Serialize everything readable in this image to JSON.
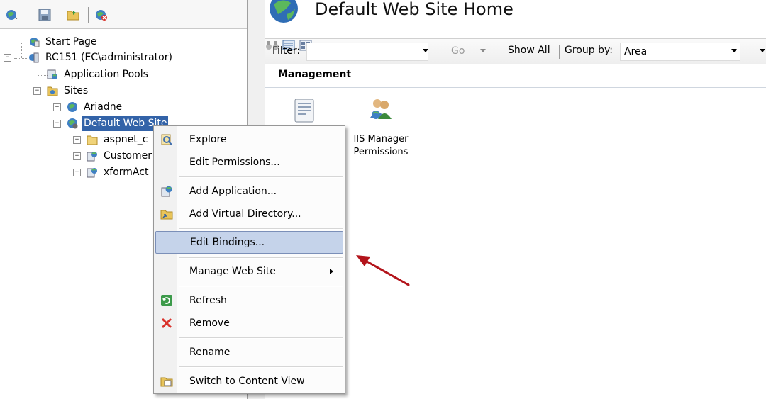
{
  "toolbar": {
    "icons": [
      "connect-globe-icon",
      "save-icon",
      "folder-icon",
      "disconnect-icon"
    ]
  },
  "tree": {
    "start_page": "Start Page",
    "server": "RC151 (EC\\administrator)",
    "app_pools": "Application Pools",
    "sites": "Sites",
    "ariadne": "Ariadne",
    "default_site": "Default Web Site",
    "aspnet": "aspnet_c",
    "customer": "Customer",
    "xform": "xformAct"
  },
  "main": {
    "title": "Default Web Site Home",
    "filter_label": "Filter:",
    "go_label": "Go",
    "show_all_label": "Show All",
    "group_by_label": "Group by:",
    "group_by_value": "Area",
    "section_label": "Management",
    "features": [
      {
        "label_line1": "",
        "label_line2": "",
        "icon": "configuration-editor-icon"
      },
      {
        "label_line1": "IIS Manager",
        "label_line2": "Permissions",
        "icon": "iis-manager-permissions-icon"
      }
    ]
  },
  "context_menu": {
    "explore": "Explore",
    "edit_permissions": "Edit Permissions...",
    "add_application": "Add Application...",
    "add_virtual_directory": "Add Virtual Directory...",
    "edit_bindings": "Edit Bindings...",
    "manage_web_site": "Manage Web Site",
    "refresh": "Refresh",
    "remove": "Remove",
    "rename": "Rename",
    "switch_content_view": "Switch to Content View"
  },
  "colors": {
    "selection": "#3363a8",
    "menu_highlight": "#c5d3ea",
    "annotation_arrow": "#b3141b"
  }
}
